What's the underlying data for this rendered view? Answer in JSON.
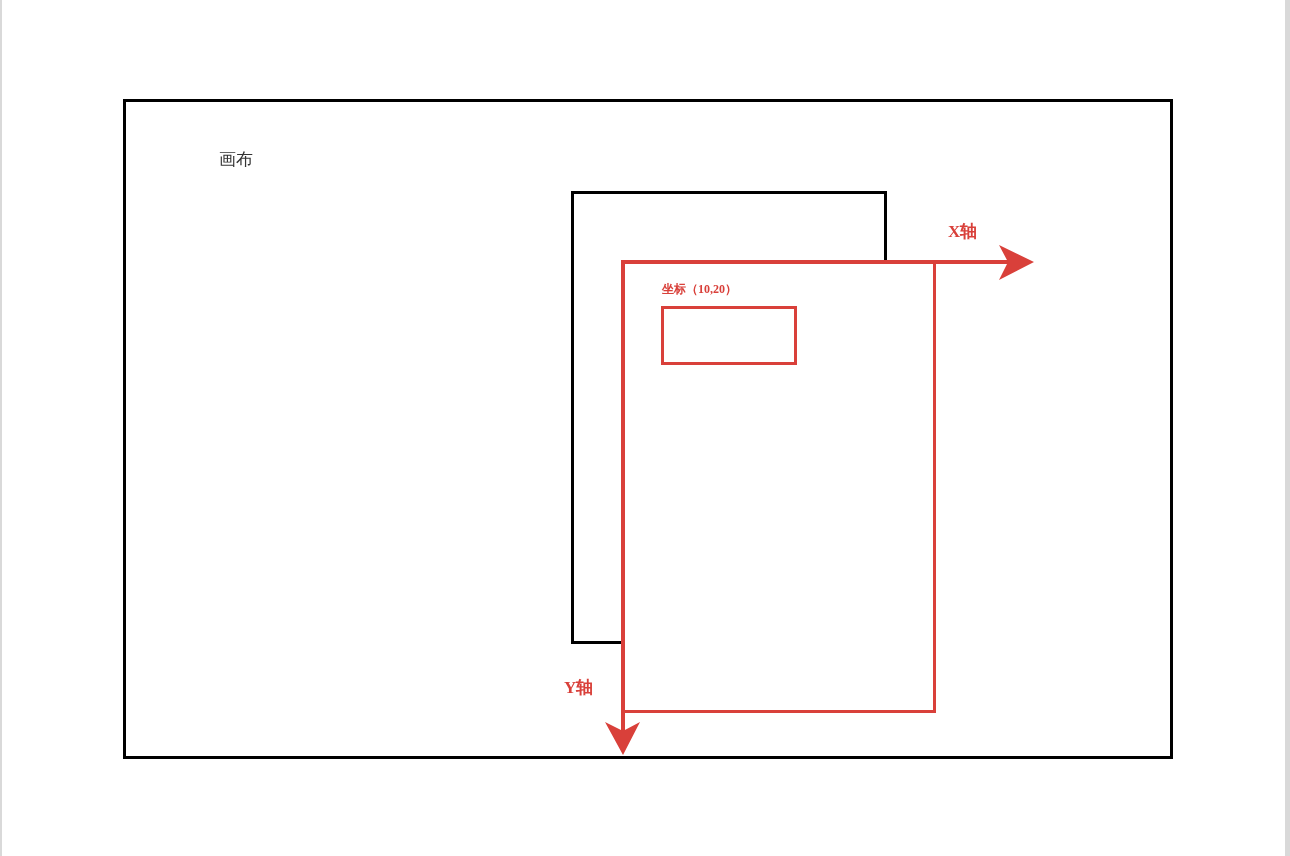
{
  "canvas_label": "画布",
  "x_axis_label": "X轴",
  "y_axis_label": "Y轴",
  "coordinate_label": "坐标（10,20）"
}
